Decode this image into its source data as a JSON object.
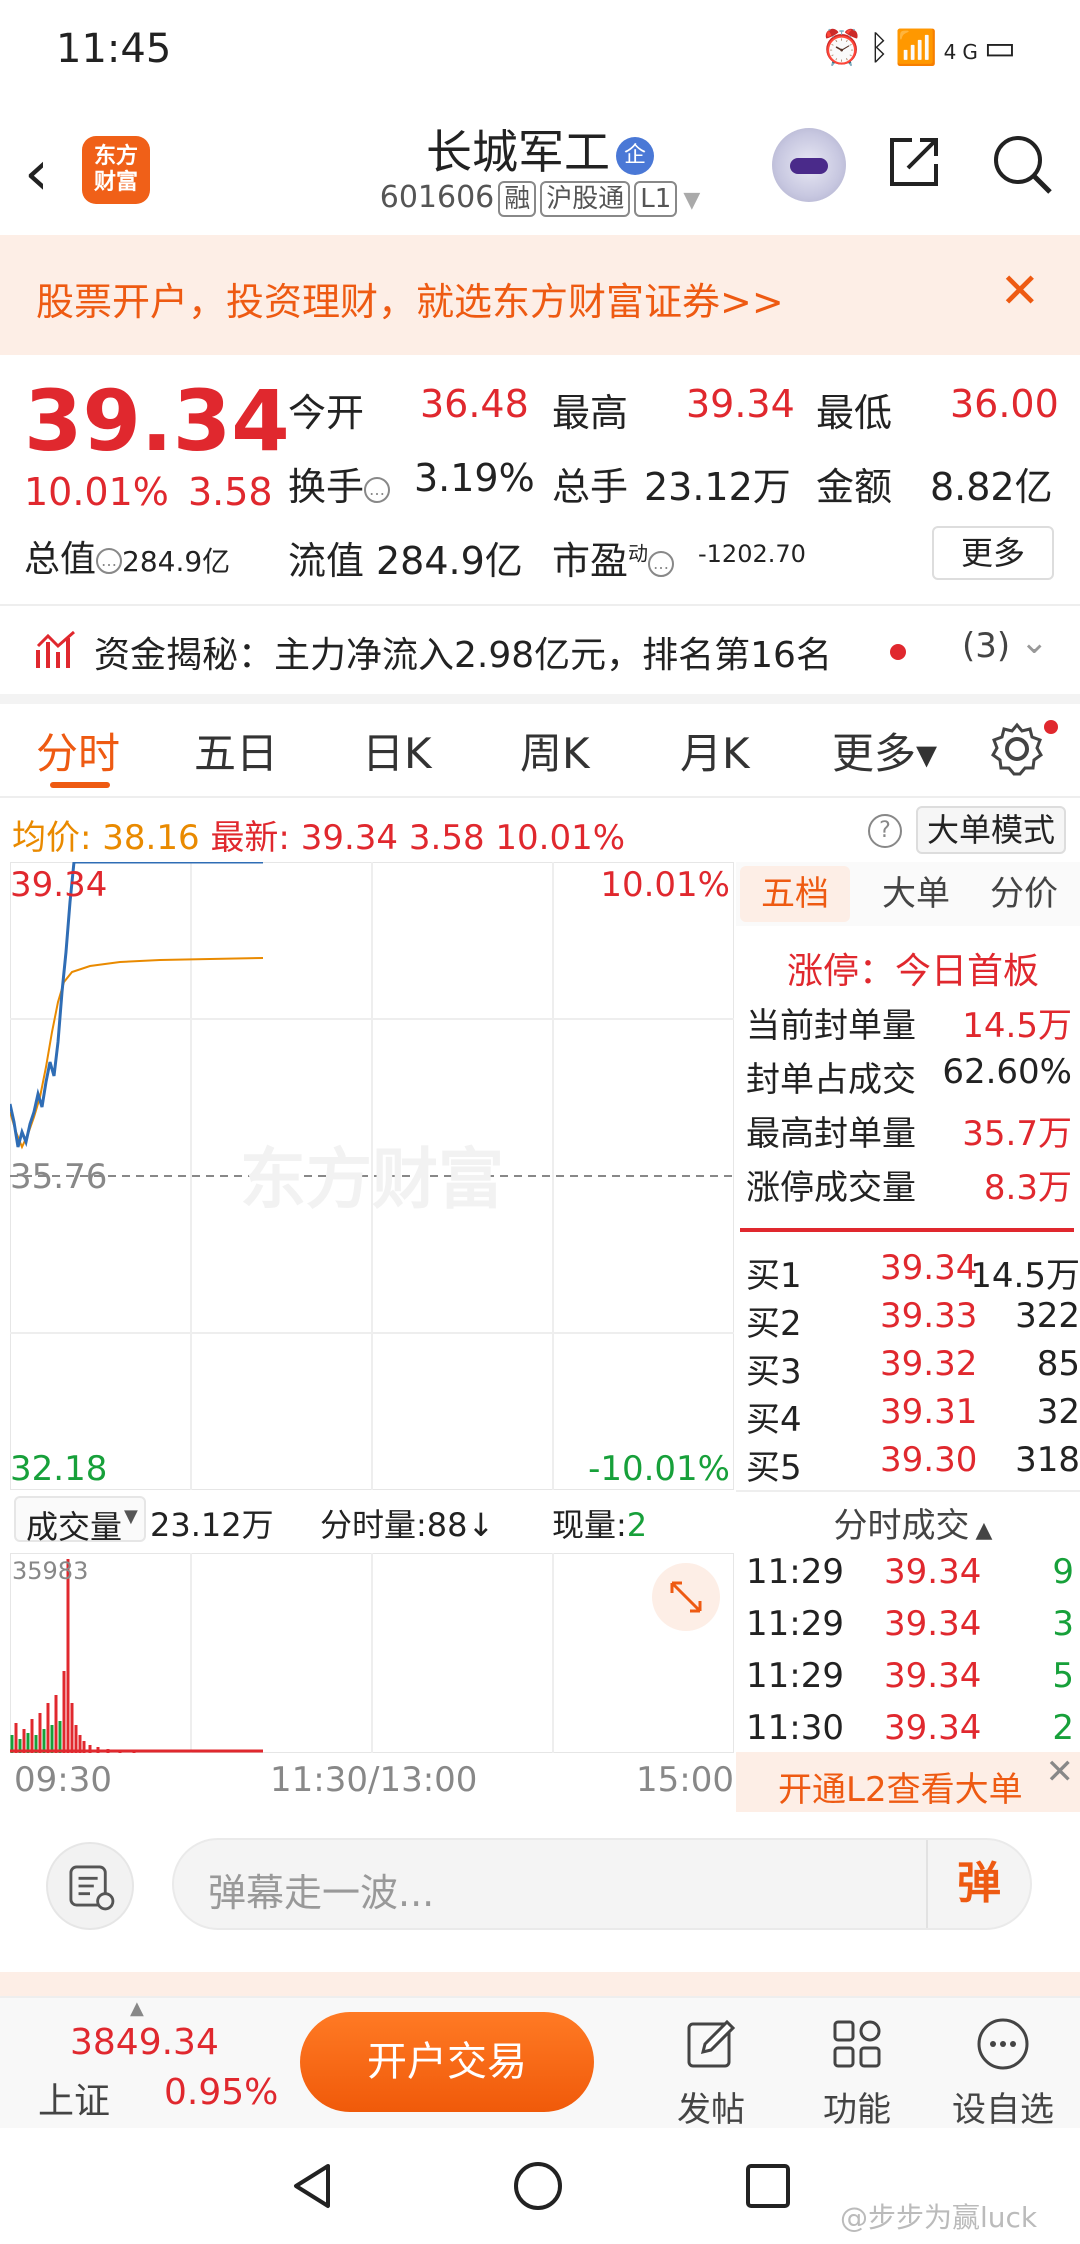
{
  "status_bar": {
    "time": "11:45",
    "network": "4G"
  },
  "header": {
    "logo_text": "东方\n财富",
    "stock_name": "长城军工",
    "enterprise_badge": "企",
    "code": "601606",
    "tag_rong": "融",
    "tag_hgt": "沪股通",
    "tag_level": "L1"
  },
  "banner": {
    "text": "股票开户，投资理财，就选东方财富证券>>"
  },
  "quote": {
    "price": "39.34",
    "change_pct": "10.01%",
    "change": "3.58",
    "open_label": "今开",
    "open": "36.48",
    "high_label": "最高",
    "high": "39.34",
    "low_label": "最低",
    "low": "36.00",
    "turnover_label": "换手",
    "turnover": "3.19%",
    "volume_label": "总手",
    "volume": "23.12万",
    "amount_label": "金额",
    "amount": "8.82亿",
    "mktcap_label": "总值",
    "mktcap": "284.9亿",
    "float_label": "流值",
    "float": "284.9亿",
    "pe_label": "市盈",
    "pe_sup": "动",
    "pe": "-1202.70",
    "more": "更多"
  },
  "funds": {
    "text": "资金揭秘：主力净流入2.98亿元，排名第16名",
    "count": "(3)"
  },
  "tabs": [
    "分时",
    "五日",
    "日K",
    "周K",
    "月K",
    "更多▾"
  ],
  "avg_line": {
    "avg_label": "均价:",
    "avg": "38.16",
    "latest_label": "最新:",
    "latest": "39.34",
    "change": "3.58",
    "pct": "10.01%",
    "mode_btn": "大单模式"
  },
  "chart": {
    "top_price": "39.34",
    "top_pct": "10.01%",
    "mid_price": "35.76",
    "bottom_price": "32.18",
    "bottom_pct": "-10.01%",
    "watermark": "东方财富"
  },
  "volume_head": {
    "label": "成交量",
    "total": "23.12万",
    "minute_label": "分时量:",
    "minute": "88↓",
    "now_label": "现量:",
    "now": "2",
    "max": "35983"
  },
  "time_axis": [
    "09:30",
    "11:30/13:00",
    "15:00"
  ],
  "panel": {
    "tabs": [
      "五档",
      "大单",
      "分价"
    ],
    "limit_title": "涨停：今日首板",
    "stats": [
      {
        "label": "当前封单量",
        "value": "14.5万"
      },
      {
        "label": "封单占成交",
        "value": "62.60%"
      },
      {
        "label": "最高封单量",
        "value": "35.7万"
      },
      {
        "label": "涨停成交量",
        "value": "8.3万"
      }
    ],
    "bids": [
      {
        "label": "买1",
        "price": "39.34",
        "vol": "14.5万"
      },
      {
        "label": "买2",
        "price": "39.33",
        "vol": "322"
      },
      {
        "label": "买3",
        "price": "39.32",
        "vol": "85"
      },
      {
        "label": "买4",
        "price": "39.31",
        "vol": "32"
      },
      {
        "label": "买5",
        "price": "39.30",
        "vol": "318"
      }
    ],
    "ticks_title": "分时成交",
    "ticks": [
      {
        "time": "11:29",
        "price": "39.34",
        "vol": "9"
      },
      {
        "time": "11:29",
        "price": "39.34",
        "vol": "3"
      },
      {
        "time": "11:29",
        "price": "39.34",
        "vol": "5"
      },
      {
        "time": "11:30",
        "price": "39.34",
        "vol": "2"
      }
    ],
    "l2_text": "开通L2查看大单"
  },
  "danmu": {
    "placeholder": "弹幕走一波...",
    "send": "弹"
  },
  "bottom_nav": {
    "index_value": "3849.34",
    "index_name": "上证",
    "index_change": "0.95%",
    "open_trade": "开户交易",
    "items": [
      "发帖",
      "功能",
      "设自选"
    ]
  },
  "watermark_text": "@步步为赢luck",
  "colors": {
    "up": "#e0282e",
    "down": "#17a03a",
    "accent": "#ee5a12",
    "avg": "#e98a00",
    "price_line": "#2f6db5"
  }
}
